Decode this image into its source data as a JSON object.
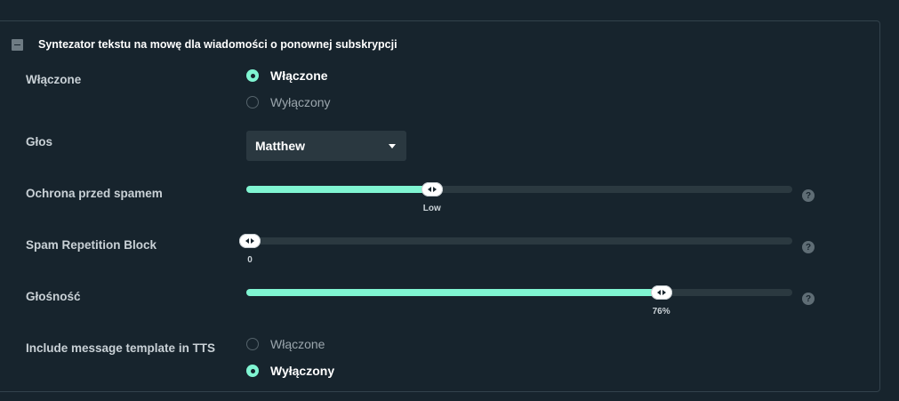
{
  "section": {
    "title": "Syntezator tekstu na mowę dla wiadomości o ponownej subskrypcji"
  },
  "enabled": {
    "label": "Włączone",
    "options": [
      {
        "label": "Włączone",
        "selected": true
      },
      {
        "label": "Wyłączony",
        "selected": false
      }
    ]
  },
  "voice": {
    "label": "Głos",
    "value": "Matthew"
  },
  "spam_protection": {
    "label": "Ochrona przed spamem",
    "value_label": "Low",
    "fraction": 0.34
  },
  "spam_repetition": {
    "label": "Spam Repetition Block",
    "value_label": "0",
    "fraction": 0.0
  },
  "volume": {
    "label": "Głośność",
    "value_label": "76%",
    "fraction": 0.76
  },
  "include_template": {
    "label": "Include message template in TTS",
    "options": [
      {
        "label": "Włączone",
        "selected": false
      },
      {
        "label": "Wyłączony",
        "selected": true
      }
    ]
  },
  "help_icon_glyph": "?",
  "colors": {
    "background": "#17242d",
    "accent": "#80f5d2",
    "track": "#2b3940"
  }
}
